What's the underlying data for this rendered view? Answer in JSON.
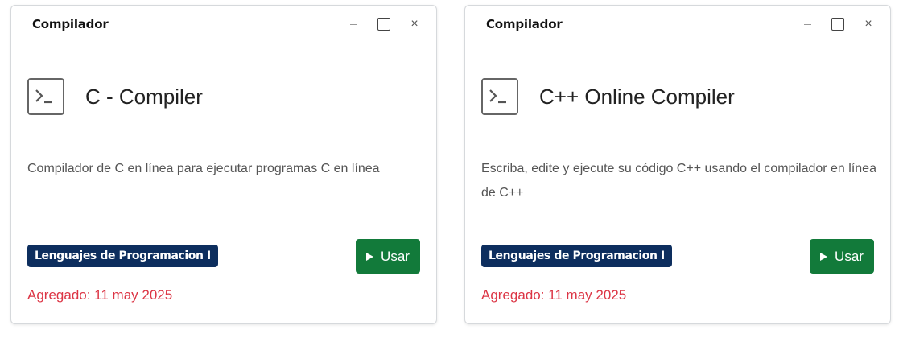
{
  "cards": [
    {
      "window_title": "Compilador",
      "name": "C - Compiler",
      "description": "Compilador de C en línea para ejecutar programas C en línea",
      "category": "Lenguajes de Programacion I",
      "button_label": "Usar",
      "added": "Agregado: 11 may 2025"
    },
    {
      "window_title": "Compilador",
      "name": "C++ Online Compiler",
      "description": "Escriba, edite y ejecute su código C++ usando el compilador en línea de C++",
      "category": "Lenguajes de Programacion I",
      "button_label": "Usar",
      "added": "Agregado: 11 may 2025"
    }
  ],
  "icons": {
    "minimize": "minimize-icon",
    "maximize": "maximize-icon",
    "close": "close-icon",
    "app": "terminal-icon",
    "play": "play-icon"
  },
  "colors": {
    "badge": "#0d2e5e",
    "button": "#127a3a",
    "added_text": "#dc3545"
  }
}
